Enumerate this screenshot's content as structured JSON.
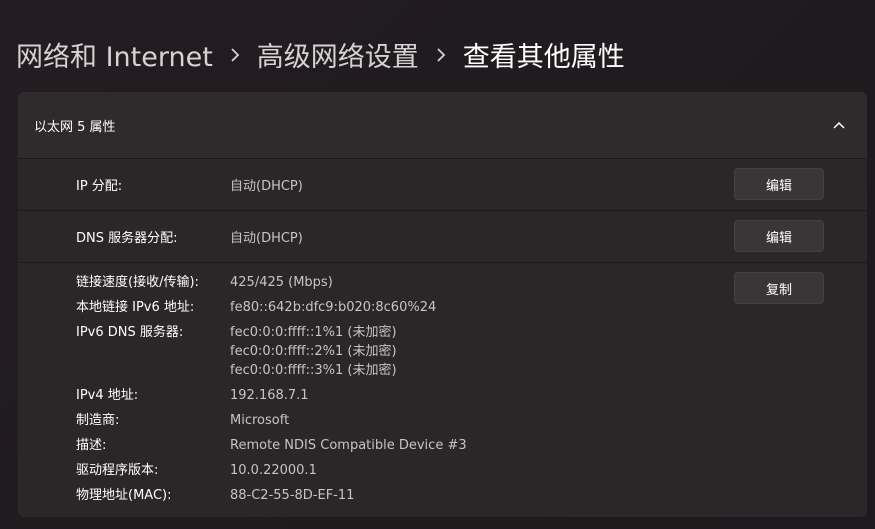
{
  "breadcrumb": {
    "items": [
      "网络和 Internet",
      "高级网络设置",
      "查看其他属性"
    ]
  },
  "card": {
    "title": "以太网 5 属性",
    "rows": [
      {
        "label": "IP 分配:",
        "value": "自动(DHCP)",
        "button": "编辑"
      },
      {
        "label": "DNS 服务器分配:",
        "value": "自动(DHCP)",
        "button": "编辑"
      }
    ],
    "details": {
      "button": "复制",
      "link_speed": {
        "label": "链接速度(接收/传输):",
        "value": "425/425 (Mbps)"
      },
      "ipv6_link_local": {
        "label": "本地链接 IPv6 地址:",
        "value": "fe80::642b:dfc9:b020:8c60%24"
      },
      "ipv6_dns": {
        "label": "IPv6 DNS 服务器:",
        "values": [
          "fec0:0:0:ffff::1%1 (未加密)",
          "fec0:0:0:ffff::2%1 (未加密)",
          "fec0:0:0:ffff::3%1 (未加密)"
        ]
      },
      "ipv4": {
        "label": "IPv4 地址:",
        "value": "192.168.7.1"
      },
      "manufacturer": {
        "label": "制造商:",
        "value": "Microsoft"
      },
      "description": {
        "label": "描述:",
        "value": "Remote NDIS Compatible Device #3"
      },
      "driver_version": {
        "label": "驱动程序版本:",
        "value": "10.0.22000.1"
      },
      "mac": {
        "label": "物理地址(MAC):",
        "value": "88-C2-55-8D-EF-11"
      }
    }
  },
  "icons": {
    "breadcrumb_separator": "chevron-right-icon",
    "collapse": "chevron-up-icon"
  }
}
